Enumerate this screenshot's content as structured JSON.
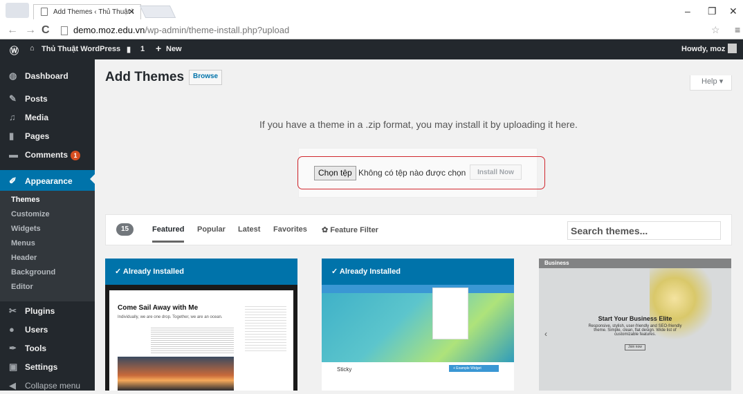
{
  "browser": {
    "tab_title": "Add Themes ‹ Thủ Thuật \\",
    "url_host": "demo.moz.edu.vn",
    "url_path": "/wp-admin/theme-install.php?upload"
  },
  "adminbar": {
    "site_name": "Thủ Thuật WordPress",
    "comments_count": "1",
    "new_label": "New",
    "greeting": "Howdy, moz"
  },
  "sidebar": {
    "items": [
      {
        "label": "Dashboard",
        "icon": "dashboard-icon"
      },
      {
        "label": "Posts",
        "icon": "pin-icon"
      },
      {
        "label": "Media",
        "icon": "media-icon"
      },
      {
        "label": "Pages",
        "icon": "pages-icon"
      },
      {
        "label": "Comments",
        "icon": "comment-icon",
        "badge": "1"
      },
      {
        "label": "Appearance",
        "icon": "brush-icon"
      },
      {
        "label": "Plugins",
        "icon": "plug-icon"
      },
      {
        "label": "Users",
        "icon": "users-icon"
      },
      {
        "label": "Tools",
        "icon": "wrench-icon"
      },
      {
        "label": "Settings",
        "icon": "settings-icon"
      },
      {
        "label": "Collapse menu",
        "icon": "collapse-icon"
      }
    ],
    "submenu": [
      "Themes",
      "Customize",
      "Widgets",
      "Menus",
      "Header",
      "Background",
      "Editor"
    ]
  },
  "main": {
    "title": "Add Themes",
    "browse_label": "Browse",
    "help_label": "Help",
    "upload_message": "If you have a theme in a .zip format, you may install it by uploading it here.",
    "choose_file_label": "Chọn tệp",
    "no_file_text": "Không có tệp nào được chọn",
    "install_label": "Install Now"
  },
  "filter": {
    "count": "15",
    "tabs": [
      "Featured",
      "Popular",
      "Latest",
      "Favorites"
    ],
    "feature_filter": "Feature Filter",
    "search_placeholder": "Search themes..."
  },
  "themes": [
    {
      "status": "Already Installed",
      "preview_title": "Come Sail Away with Me",
      "preview_subtitle": "Individually, we are one drop. Together, we are an ocean."
    },
    {
      "status": "Already Installed",
      "preview_title": "Sticky",
      "widget_label": "+ Example Widget"
    },
    {
      "brand": "Business",
      "headline": "Start Your Business Elite",
      "tagline": "Responsive, stylish, user-friendly and SEO-friendly theme. Simple, clean, flat design. Wide list of customizable features.",
      "button": "Join now"
    }
  ],
  "colors": {
    "admin_dark": "#23282d",
    "accent": "#0073aa",
    "highlight_outline": "#d0262d"
  }
}
